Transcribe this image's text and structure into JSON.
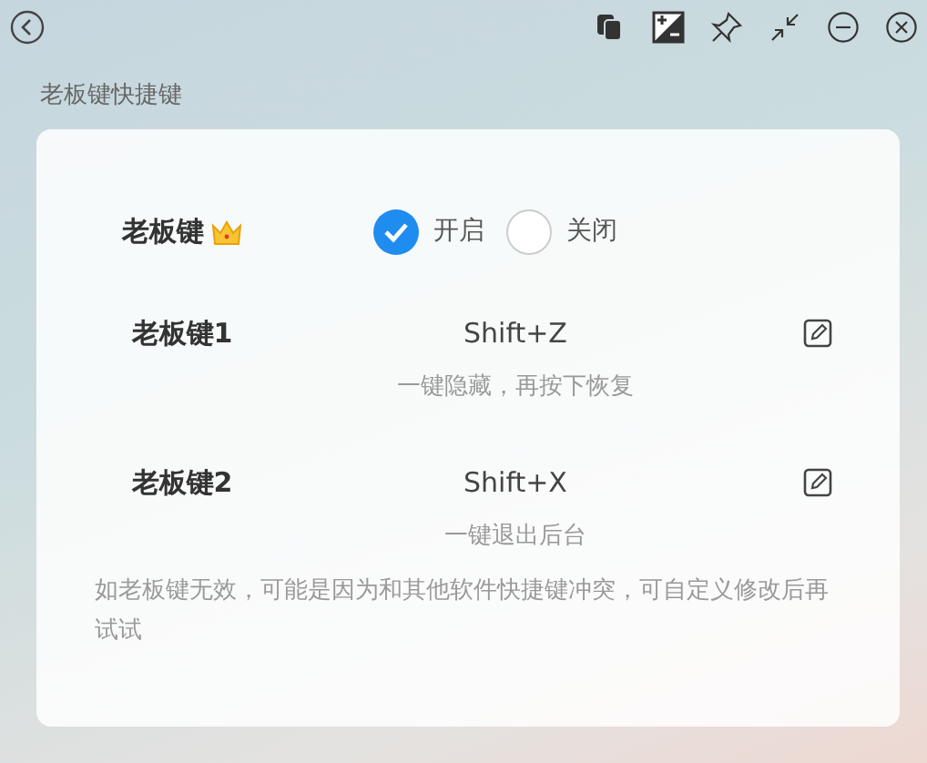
{
  "section_title": "老板键快捷键",
  "boss_key": {
    "label": "老板键",
    "options": [
      {
        "label": "开启",
        "selected": true
      },
      {
        "label": "关闭",
        "selected": false
      }
    ]
  },
  "shortcuts": [
    {
      "label": "老板键1",
      "keys": "Shift+Z",
      "description": "一键隐藏，再按下恢复"
    },
    {
      "label": "老板键2",
      "keys": "Shift+X",
      "description": "一键退出后台"
    }
  ],
  "note": "如老板键无效，可能是因为和其他软件快捷键冲突，可自定义修改后再试试"
}
